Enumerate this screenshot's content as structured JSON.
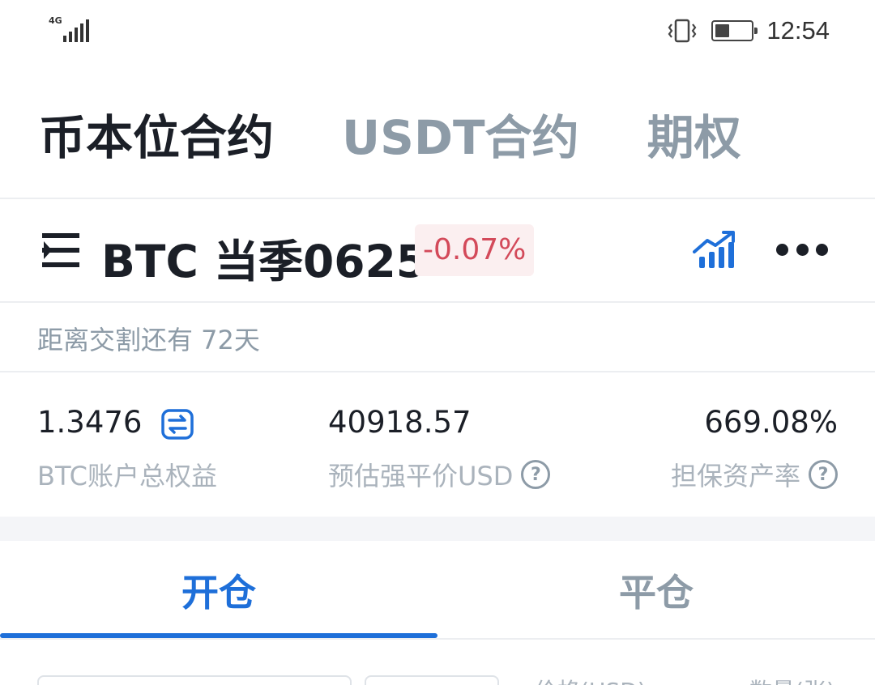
{
  "status_bar": {
    "network": "4G",
    "clock": "12:54",
    "battery_fraction": 0.35
  },
  "top_tabs": [
    {
      "label": "币本位合约",
      "active": true
    },
    {
      "label": "USDT合约",
      "active": false
    },
    {
      "label": "期权",
      "active": false
    }
  ],
  "contract": {
    "title": "BTC 当季0625",
    "change": "-0.07%"
  },
  "delivery_text": "距离交割还有 72天",
  "stats": {
    "equity_value": "1.3476",
    "equity_label": "BTC账户总权益",
    "liq_price_value": "40918.57",
    "liq_price_label": "预估强平价USD",
    "margin_ratio_value": "669.08%",
    "margin_ratio_label": "担保资产率"
  },
  "trade_tabs": [
    {
      "label": "开仓",
      "active": true
    },
    {
      "label": "平仓",
      "active": false
    }
  ],
  "form": {
    "price_label": "价格(USD)",
    "amount_label": "数量(张)"
  },
  "colors": {
    "accent": "#1e6fd9",
    "negative": "#d34a5a",
    "muted": "#8d9ba7"
  }
}
